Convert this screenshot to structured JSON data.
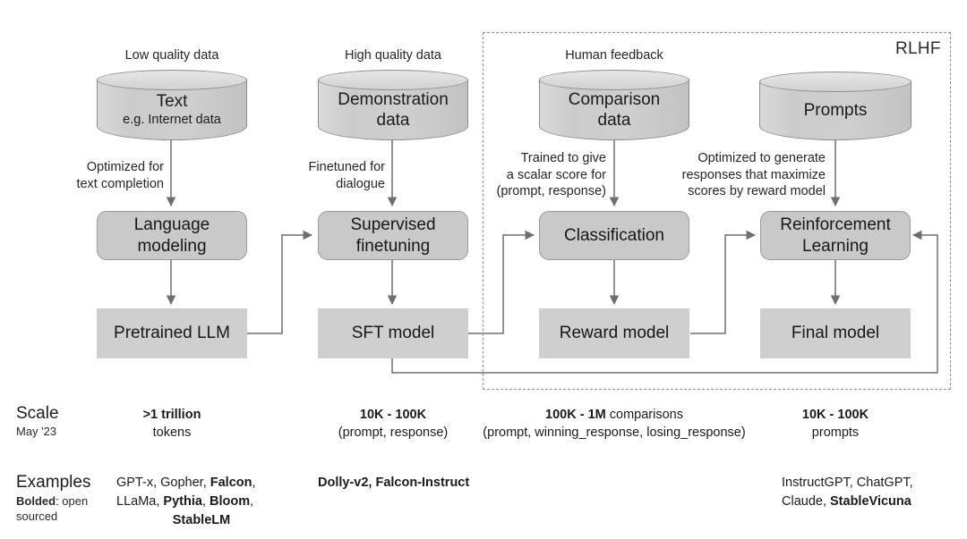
{
  "diagram": {
    "region_label": "RLHF",
    "columns": [
      {
        "id": "pretraining",
        "caption": "Low quality data",
        "datastore_title": "Text",
        "datastore_subtitle": "e.g. Internet data",
        "edge_label": "Optimized for\ntext completion",
        "process": "Language\nmodeling",
        "artifact": "Pretrained LLM"
      },
      {
        "id": "sft",
        "caption": "High quality data",
        "datastore_title": "Demonstration",
        "datastore_subtitle": "data",
        "edge_label": "Finetuned for\ndialogue",
        "process": "Supervised\nfinetuning",
        "artifact": "SFT model"
      },
      {
        "id": "reward-modeling",
        "caption": "Human feedback",
        "datastore_title": "Comparison",
        "datastore_subtitle": "data",
        "edge_label": "Trained to give\na scalar score for\n(prompt, response)",
        "process": "Classification",
        "artifact": "Reward model"
      },
      {
        "id": "rl-finetuning",
        "caption": "",
        "datastore_title": "Prompts",
        "datastore_subtitle": "",
        "edge_label": "Optimized to generate\nresponses that maximize\nscores by reward model",
        "process": "Reinforcement\nLearning",
        "artifact": "Final model"
      }
    ],
    "boxes": {
      "language_modeling_line1": "Language",
      "language_modeling_line2": "modeling",
      "supervised_finetuning_line1": "Supervised",
      "supervised_finetuning_line2": "finetuning",
      "classification": "Classification",
      "reinforcement_learning_line1": "Reinforcement",
      "reinforcement_learning_line2": "Learning",
      "pretrained_llm": "Pretrained LLM",
      "sft_model": "SFT model",
      "reward_model": "Reward model",
      "final_model": "Final model"
    },
    "edge_labels": {
      "pretraining_line1": "Optimized for",
      "pretraining_line2": "text completion",
      "sft_line1": "Finetuned for",
      "sft_line2": "dialogue",
      "reward_line1": "Trained to give",
      "reward_line2": "a scalar score for",
      "reward_line3": "(prompt, response)",
      "rl_line1": "Optimized to generate",
      "rl_line2": "responses that maximize",
      "rl_line3": "scores by reward model"
    },
    "datastore_captions": {
      "low_quality": "Low quality data",
      "high_quality": "High quality data",
      "human_feedback": "Human feedback"
    },
    "datastores": {
      "text_title": "Text",
      "text_sub": "e.g. Internet data",
      "demo_title": "Demonstration",
      "demo_sub": "data",
      "comparison_title": "Comparison",
      "comparison_sub": "data",
      "prompts_title": "Prompts"
    }
  },
  "scale_row": {
    "label": "Scale",
    "sublabel": "May '23",
    "cells": [
      {
        "bold": ">1 trillion",
        "plain": "tokens"
      },
      {
        "bold": "10K - 100K",
        "plain": "(prompt, response)"
      },
      {
        "bold": "100K - 1M",
        "plain_inline": " comparisons",
        "plain": "(prompt, winning_response, losing_response)"
      },
      {
        "bold": "10K - 100K",
        "plain": "prompts"
      }
    ]
  },
  "examples_row": {
    "label": "Examples",
    "sublabel_bold": "Bolded",
    "sublabel_rest": ": open",
    "sublabel_line2": "sourced",
    "cells": [
      {
        "line1_a": "GPT-x, Gopher, ",
        "line1_b": "Falcon",
        "line1_c": ",",
        "line2_a": "LLaMa, ",
        "line2_b": "Pythia",
        "line2_c": ", ",
        "line2_d": "Bloom",
        "line2_e": ",",
        "line3_b": "StableLM"
      },
      {
        "line1_b": "Dolly-v2, Falcon-Instruct"
      },
      {
        "line1_a": "InstructGPT, ChatGPT,",
        "line2_a": "Claude, ",
        "line2_b": "StableVicuna"
      }
    ]
  },
  "colors": {
    "box_fill": "#c9c9c9",
    "artifact_fill": "#cfcfcf",
    "stroke": "#6e6e6e",
    "dashed_stroke": "#8d8d8d",
    "text": "#1b1b1b",
    "background": "#ffffff"
  }
}
